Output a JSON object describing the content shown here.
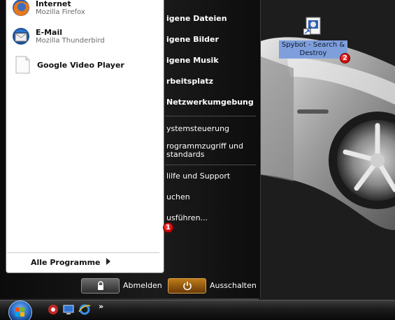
{
  "start_menu": {
    "pinned": [
      {
        "name": "Internet",
        "sub": "Mozilla Firefox",
        "icon": "firefox-icon"
      },
      {
        "name": "E-Mail",
        "sub": "Mozilla Thunderbird",
        "icon": "thunderbird-icon"
      }
    ],
    "recent": [
      {
        "name": "Google Video Player",
        "icon": "document-icon"
      }
    ],
    "all_programs": "Alle Programme",
    "right_items": [
      "igene Dateien",
      "igene Bilder",
      "igene Musik",
      "rbeitsplatz",
      "Netzwerkumgebung",
      "ystemsteuerung",
      "rogrammzugriff und",
      "standards",
      "lilfe und Support",
      "uchen",
      "usführen..."
    ],
    "logoff_label": "Abmelden",
    "shutdown_label": "Ausschalten"
  },
  "desktop": {
    "icon_label_line1": "Spybot - Search &",
    "icon_label_line2": "Destroy"
  },
  "markers": {
    "one": "1",
    "two": "2"
  },
  "taskbar": {
    "more": "»"
  },
  "colors": {
    "marker_red": "#c40000",
    "selection_blue": "#7f9fdc",
    "power_orange": "#bf7b1a"
  }
}
